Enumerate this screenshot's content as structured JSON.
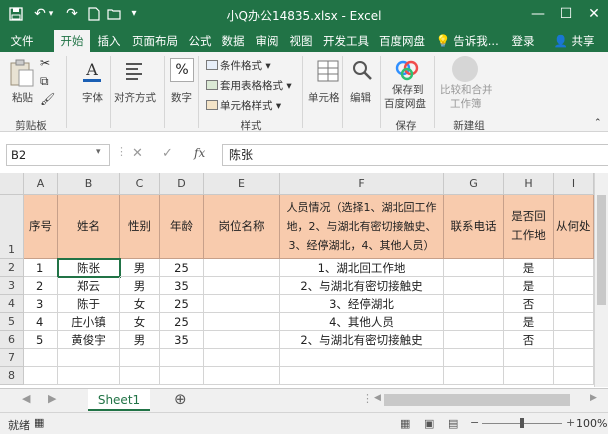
{
  "window": {
    "title": "小Q办公14835.xlsx - Excel",
    "controls": [
      "—",
      "☐",
      "✕"
    ]
  },
  "quick_access": {
    "save": "save-icon",
    "undo": "undo-icon",
    "redo": "redo-icon"
  },
  "tabs": [
    "文件",
    "开始",
    "插入",
    "页面布局",
    "公式",
    "数据",
    "审阅",
    "视图",
    "开发工具",
    "百度网盘"
  ],
  "active_tab": "开始",
  "tell_me": "告诉我...",
  "login": "登录",
  "share": "共享",
  "ribbon": {
    "paste": "粘贴",
    "clipboard": "剪贴板",
    "font": "字体",
    "alignment": "对齐方式",
    "number": "数字",
    "percent_symbol": "%",
    "conditional_format": "条件格式",
    "table_format": "套用表格格式",
    "cell_style": "单元格样式",
    "styles": "样式",
    "cells": "单元格",
    "edit": "编辑",
    "save_to_baidu_1": "保存到",
    "save_to_baidu_2": "百度网盘",
    "save_group": "保存",
    "compare_merge_1": "比较和合并",
    "compare_merge_2": "工作簿",
    "new_group": "新建组"
  },
  "formula_bar": {
    "name_box": "B2",
    "fx": "fx",
    "cancel": "✕",
    "enter": "✓",
    "value": "陈张"
  },
  "grid": {
    "columns": [
      "A",
      "B",
      "C",
      "D",
      "E",
      "F",
      "G",
      "H",
      "I"
    ],
    "rows": [
      "1",
      "2",
      "3",
      "4",
      "5",
      "6",
      "7",
      "8"
    ],
    "header": [
      "序号",
      "姓名",
      "性别",
      "年龄",
      "岗位名称",
      "人员情况（选择1、湖北回工作地，2、与湖北有密切接触史、3、经停湖北，4、其他人员）",
      "联系电话",
      "是否回工作地",
      "从何处"
    ],
    "data": [
      [
        "1",
        "陈张",
        "男",
        "25",
        "",
        "1、湖北回工作地",
        "",
        "是",
        ""
      ],
      [
        "2",
        "郑云",
        "男",
        "35",
        "",
        "2、与湖北有密切接触史",
        "",
        "是",
        ""
      ],
      [
        "3",
        "陈于",
        "女",
        "25",
        "",
        "3、经停湖北",
        "",
        "否",
        ""
      ],
      [
        "4",
        "庄小镇",
        "女",
        "25",
        "",
        "4、其他人员",
        "",
        "是",
        ""
      ],
      [
        "5",
        "黄俊宇",
        "男",
        "35",
        "",
        "2、与湖北有密切接触史",
        "",
        "否",
        ""
      ]
    ]
  },
  "sheet_tabs": {
    "active": "Sheet1",
    "add": "⊕"
  },
  "status": {
    "mode": "就绪",
    "zoom": "100%"
  },
  "colors": {
    "accent": "#217346",
    "header_fill": "#f8cbad"
  }
}
